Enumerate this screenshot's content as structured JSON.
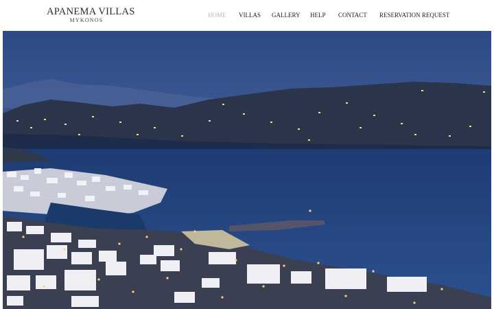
{
  "logo": {
    "title": "APANEMA VILLAS",
    "subtitle": "MYKONOS"
  },
  "nav": {
    "items": [
      {
        "label": "HOME",
        "active": true
      },
      {
        "label": "VILLAS",
        "active": false
      },
      {
        "label": "GALLERY",
        "active": false
      },
      {
        "label": "HELP",
        "active": false
      },
      {
        "label": "CONTACT",
        "active": false
      },
      {
        "label": "RESERVATION REQUEST",
        "active": false
      }
    ]
  },
  "hero": {
    "alt": "Mykonos harbour at dusk"
  },
  "colors": {
    "active_nav": "#b9b9b9",
    "nav_text": "#1c1c1c",
    "sky": "#3c5a96",
    "sea": "#24447a"
  }
}
